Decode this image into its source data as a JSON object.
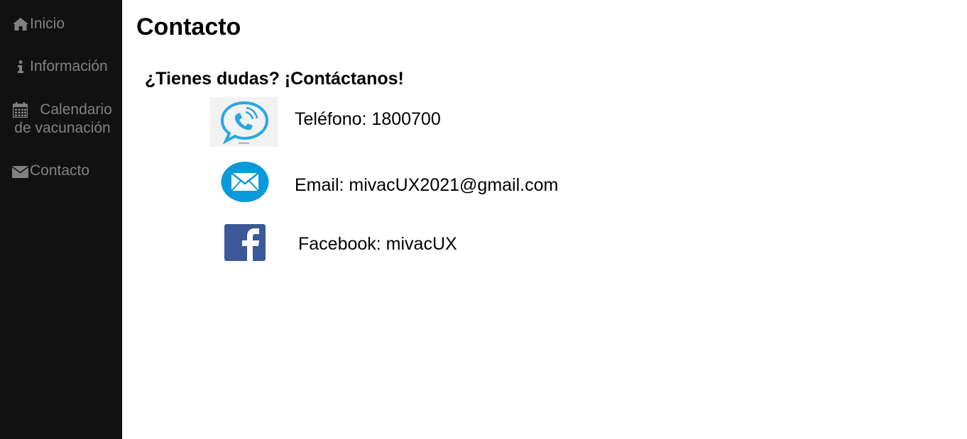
{
  "sidebar": {
    "items": [
      {
        "label": "Inicio",
        "icon": "home-icon"
      },
      {
        "label": "Información",
        "icon": "info-icon"
      },
      {
        "label": "Calendario de vacunación",
        "icon": "calendar-icon"
      },
      {
        "label": "Contacto",
        "icon": "envelope-icon"
      }
    ]
  },
  "main": {
    "title": "Contacto",
    "subtitle": "¿Tienes dudas? ¡Contáctanos!",
    "contacts": [
      {
        "text": "Teléfono: 1800700",
        "icon": "phone-chat-icon"
      },
      {
        "text": "Email: mivacUX2021@gmail.com",
        "icon": "email-icon"
      },
      {
        "text": "Facebook: mivacUX",
        "icon": "facebook-icon"
      }
    ]
  },
  "colors": {
    "sidebar_bg": "#111111",
    "sidebar_text": "#818181",
    "phone_icon_blue": "#2aa7e0",
    "email_icon_blue": "#0a9ad9",
    "facebook_blue": "#3b5998"
  }
}
